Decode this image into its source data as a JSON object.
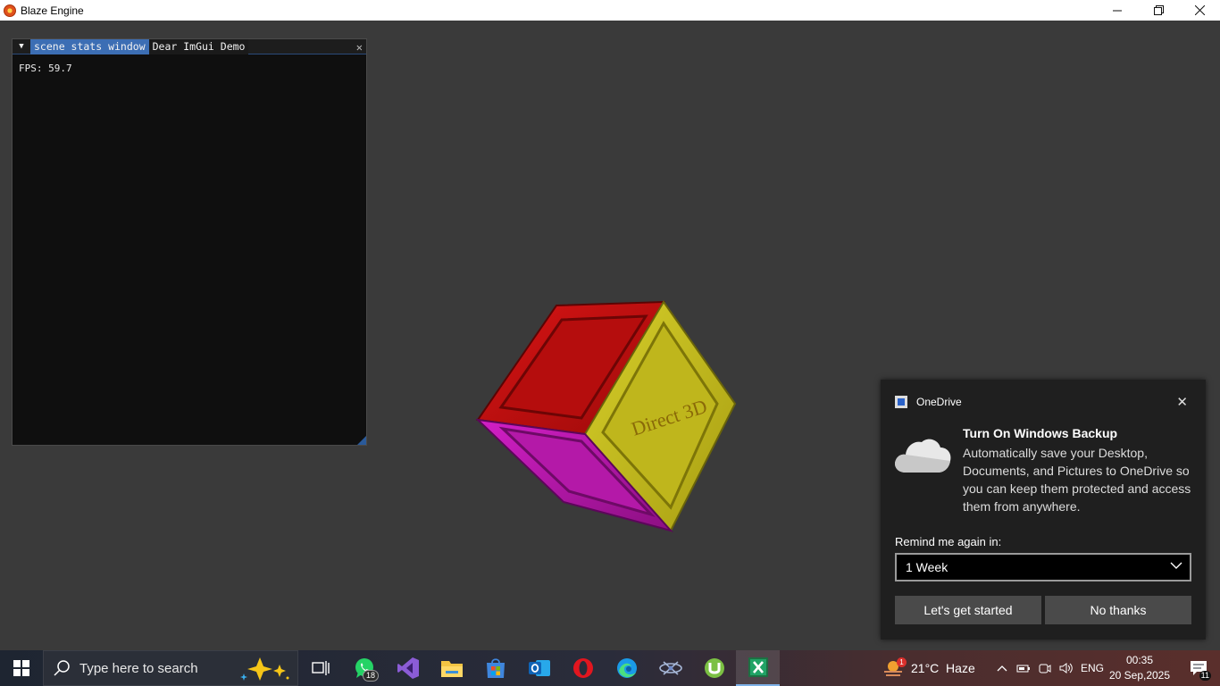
{
  "window": {
    "title": "Blaze Engine",
    "minimize": "—",
    "restore": "❐",
    "close": "✕"
  },
  "imgui": {
    "tabs": [
      {
        "label": "scene stats window",
        "active": true
      },
      {
        "label": "Dear ImGui Demo",
        "active": false
      }
    ],
    "menu_glyph": "▼",
    "close_glyph": "✕",
    "fps_text": "FPS: 59.7"
  },
  "scene": {
    "cube_label": "Direct 3D",
    "face_colors": {
      "top": "#c41010",
      "right": "#c9c01a",
      "left": "#c817b8"
    }
  },
  "toast": {
    "app_name": "OneDrive",
    "close_glyph": "✕",
    "title": "Turn On Windows Backup",
    "message": "Automatically save your Desktop, Documents, and Pictures to OneDrive so you can keep them protected and access them from anywhere.",
    "remind_label": "Remind me again in:",
    "remind_value": "1 Week",
    "primary_button": "Let's get started",
    "secondary_button": "No thanks"
  },
  "taskbar": {
    "search_placeholder": "Type here to search",
    "whatsapp_badge": "18",
    "weather_alert": "1",
    "weather": "21°C  Haze",
    "language": "ENG",
    "time": "00:35",
    "date": "20 Sep,2025",
    "notification_count": "11",
    "apps": [
      "task-view",
      "whatsapp",
      "visual-studio",
      "file-explorer",
      "microsoft-store",
      "outlook",
      "opera",
      "edge",
      "game-app",
      "utorrent",
      "excel"
    ]
  }
}
